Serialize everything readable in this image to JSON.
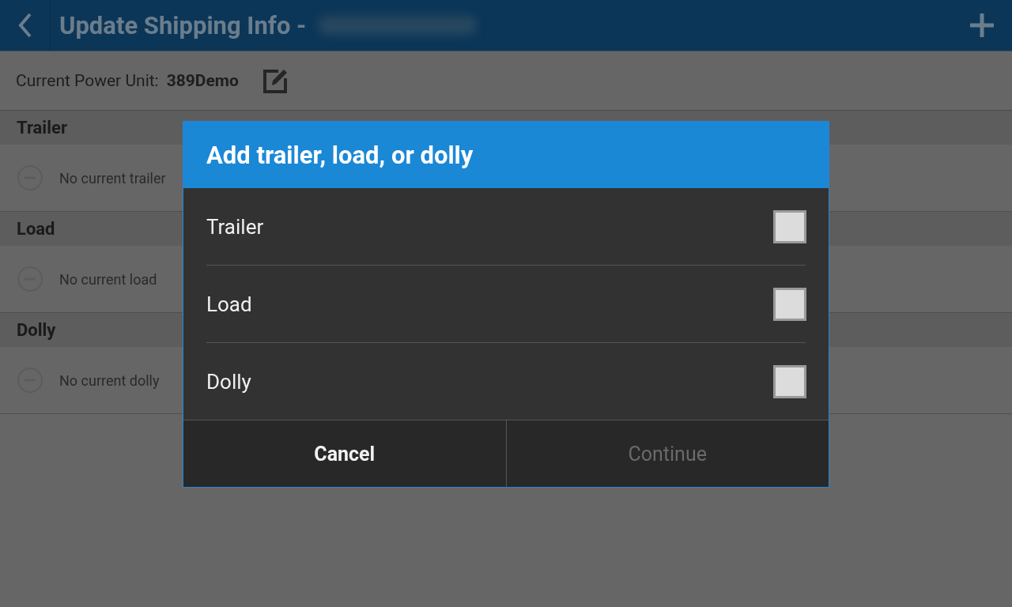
{
  "header": {
    "title": "Update Shipping Info -"
  },
  "power_unit": {
    "label": "Current Power Unit:",
    "value": "389Demo"
  },
  "sections": [
    {
      "title": "Trailer",
      "empty_text": "No current trailer"
    },
    {
      "title": "Load",
      "empty_text": "No current load"
    },
    {
      "title": "Dolly",
      "empty_text": "No current dolly"
    }
  ],
  "dialog": {
    "title": "Add trailer, load, or dolly",
    "options": [
      {
        "label": "Trailer",
        "checked": false
      },
      {
        "label": "Load",
        "checked": false
      },
      {
        "label": "Dolly",
        "checked": false
      }
    ],
    "buttons": [
      {
        "label": "Cancel",
        "disabled": false
      },
      {
        "label": "Continue",
        "disabled": true
      }
    ]
  }
}
